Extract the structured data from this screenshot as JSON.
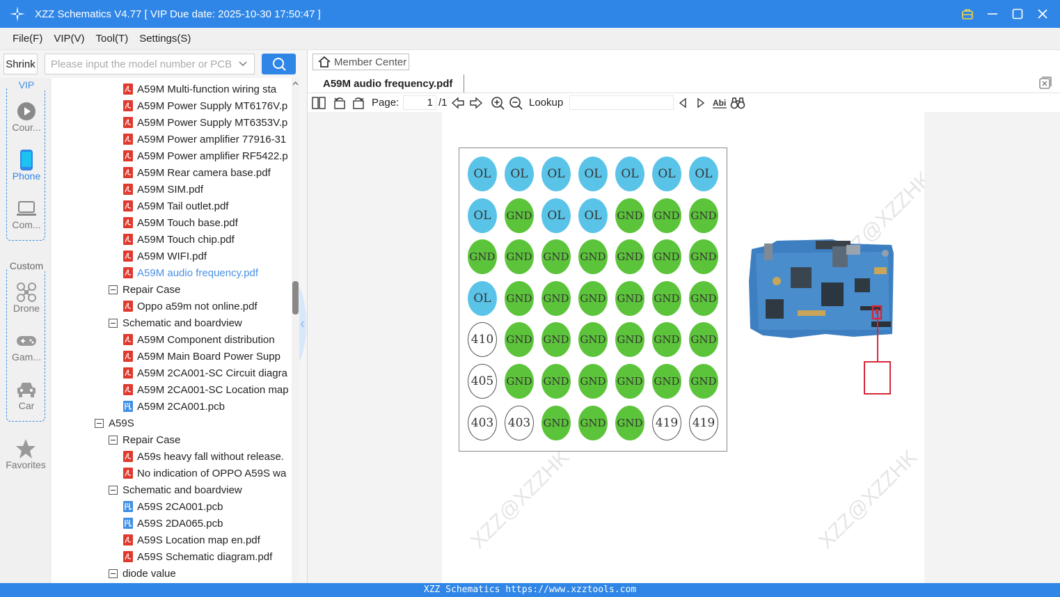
{
  "window": {
    "title": "XZZ Schematics V4.77 [ VIP Due date: 2025-10-30 17:50:47 ]"
  },
  "menu": {
    "items": [
      "File(F)",
      "VIP(V)",
      "Tool(T)",
      "Settings(S)"
    ]
  },
  "search": {
    "shrink_label": "Shrink",
    "placeholder": "Please input the model number or PCB"
  },
  "nav": {
    "vip_label": "VIP",
    "custom_label": "Custom",
    "items": {
      "course": "Cour...",
      "phone": "Phone",
      "computer": "Com...",
      "drone": "Drone",
      "game": "Gam...",
      "car": "Car",
      "favorites": "Favorites"
    }
  },
  "tree": {
    "rows": [
      {
        "type": "pdf",
        "label": "A59M Multi-function wiring sta"
      },
      {
        "type": "pdf",
        "label": "A59M Power Supply MT6176V.p"
      },
      {
        "type": "pdf",
        "label": "A59M Power Supply MT6353V.p"
      },
      {
        "type": "pdf",
        "label": "A59M Power amplifier 77916-31"
      },
      {
        "type": "pdf",
        "label": "A59M Power amplifier RF5422.p"
      },
      {
        "type": "pdf",
        "label": "A59M Rear camera base.pdf"
      },
      {
        "type": "pdf",
        "label": "A59M SIM.pdf"
      },
      {
        "type": "pdf",
        "label": "A59M Tail outlet.pdf"
      },
      {
        "type": "pdf",
        "label": "A59M Touch base.pdf"
      },
      {
        "type": "pdf",
        "label": "A59M Touch chip.pdf"
      },
      {
        "type": "pdf",
        "label": "A59M WIFI.pdf"
      },
      {
        "type": "pdf",
        "label": "A59M audio frequency.pdf",
        "selected": true
      },
      {
        "type": "folder",
        "label": "Repair Case"
      },
      {
        "type": "pdf",
        "label": "Oppo a59m not online.pdf"
      },
      {
        "type": "folder",
        "label": "Schematic and boardview"
      },
      {
        "type": "pdf",
        "label": "A59M  Component distribution"
      },
      {
        "type": "pdf",
        "label": "A59M  Main Board Power Supp"
      },
      {
        "type": "pdf",
        "label": "A59M 2CA001-SC Circuit diagra"
      },
      {
        "type": "pdf",
        "label": "A59M 2CA001-SC Location map"
      },
      {
        "type": "pcb",
        "label": "A59M 2CA001.pcb"
      },
      {
        "type": "model",
        "label": "A59S"
      },
      {
        "type": "folder",
        "label": "Repair Case"
      },
      {
        "type": "pdf",
        "label": "A59s heavy fall without release."
      },
      {
        "type": "pdf",
        "label": "No indication of OPPO A59S wa"
      },
      {
        "type": "folder",
        "label": "Schematic and boardview"
      },
      {
        "type": "pcb",
        "label": "A59S 2CA001.pcb"
      },
      {
        "type": "pcb",
        "label": "A59S 2DA065.pcb"
      },
      {
        "type": "pdf",
        "label": "A59S Location map en.pdf"
      },
      {
        "type": "pdf",
        "label": "A59S Schematic diagram.pdf"
      },
      {
        "type": "folder",
        "label": "diode value"
      }
    ]
  },
  "viewer": {
    "member_center": "Member Center",
    "tab_title": "A59M audio frequency.pdf",
    "page_label": "Page:",
    "page_current": "1",
    "page_total": "/1",
    "lookup_label": "Lookup",
    "lookup_value": ""
  },
  "diagram": {
    "rows": [
      [
        "OL",
        "OL",
        "OL",
        "OL",
        "OL",
        "OL",
        "OL"
      ],
      [
        "OL",
        "GND",
        "OL",
        "OL",
        "GND",
        "GND",
        "GND"
      ],
      [
        "GND",
        "GND",
        "GND",
        "GND",
        "GND",
        "GND",
        "GND"
      ],
      [
        "OL",
        "GND",
        "GND",
        "GND",
        "GND",
        "GND",
        "GND"
      ],
      [
        "410",
        "GND",
        "GND",
        "GND",
        "GND",
        "GND",
        "GND"
      ],
      [
        "405",
        "GND",
        "GND",
        "GND",
        "GND",
        "GND",
        "GND"
      ],
      [
        "403",
        "403",
        "GND",
        "GND",
        "GND",
        "419",
        "419"
      ]
    ],
    "colors": {
      "ol": "#5ac4e8",
      "gnd": "#5cc43a",
      "marker": "#d8263a"
    },
    "watermark": "XZZ@XZZHK"
  },
  "status": {
    "text": "XZZ Schematics https://www.xzztools.com"
  }
}
